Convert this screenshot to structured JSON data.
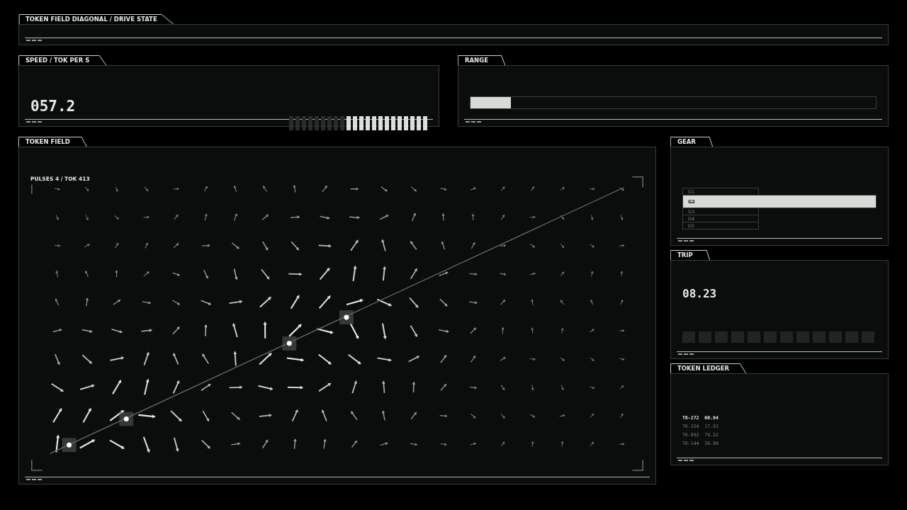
{
  "header": {
    "title": "TOKEN FIELD DIAGONAL / DRIVE STATE"
  },
  "speed": {
    "title": "SPEED / TOK PER S",
    "value": "057.2",
    "level": 0.59
  },
  "range": {
    "title": "RANGE",
    "level": 0.1
  },
  "field": {
    "title": "TOKEN FIELD",
    "readout": "PULSES 4 / TOK 413"
  },
  "gear": {
    "title": "GEAR",
    "items": [
      {
        "label": "G1",
        "selected": false
      },
      {
        "label": "G2",
        "selected": true
      },
      {
        "label": "G3",
        "selected": false
      },
      {
        "label": "G4",
        "selected": false
      },
      {
        "label": "G5",
        "selected": false
      }
    ]
  },
  "trip": {
    "title": "TRIP",
    "value": "08.23",
    "level": 0
  },
  "ledger": {
    "title": "TOKEN LEDGER",
    "rows": [
      {
        "id": "TK-272",
        "value": "00.94",
        "selected": true
      },
      {
        "id": "TK-324",
        "value": "17.93",
        "selected": false
      },
      {
        "id": "TK-892",
        "value": "79.22",
        "selected": false
      },
      {
        "id": "TK-144",
        "value": "39.90",
        "selected": false
      }
    ]
  }
}
